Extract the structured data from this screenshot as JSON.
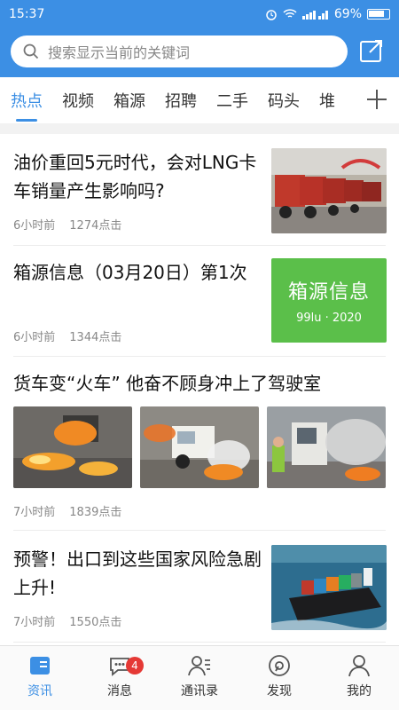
{
  "status": {
    "time": "15:37",
    "battery": "69%"
  },
  "search": {
    "placeholder": "搜索显示当前的关键词"
  },
  "tabs": [
    "热点",
    "视频",
    "箱源",
    "招聘",
    "二手",
    "码头",
    "堆"
  ],
  "feed": [
    {
      "title": "油价重回5元时代，会对LNG卡车销量产生影响吗?",
      "time": "6小时前",
      "clicks": "1274点击"
    },
    {
      "title": "箱源信息（03月20日）第1次",
      "time": "6小时前",
      "clicks": "1344点击",
      "badge_title": "箱源信息",
      "badge_sub": "99lu · 2020"
    },
    {
      "title": "货车变“火车” 他奋不顾身冲上了驾驶室",
      "time": "7小时前",
      "clicks": "1839点击"
    },
    {
      "title": "预警！出口到这些国家风险急剧上升!",
      "time": "7小时前",
      "clicks": "1550点击"
    }
  ],
  "tabbar": {
    "items": [
      {
        "label": "资讯",
        "icon": "news-icon"
      },
      {
        "label": "消息",
        "icon": "chat-icon",
        "badge": "4"
      },
      {
        "label": "通讯录",
        "icon": "contacts-icon"
      },
      {
        "label": "发现",
        "icon": "discover-icon"
      },
      {
        "label": "我的",
        "icon": "profile-icon"
      }
    ]
  },
  "colors": {
    "primary": "#3c8fe4",
    "badge": "#e53935",
    "green": "#5bbf4a"
  }
}
